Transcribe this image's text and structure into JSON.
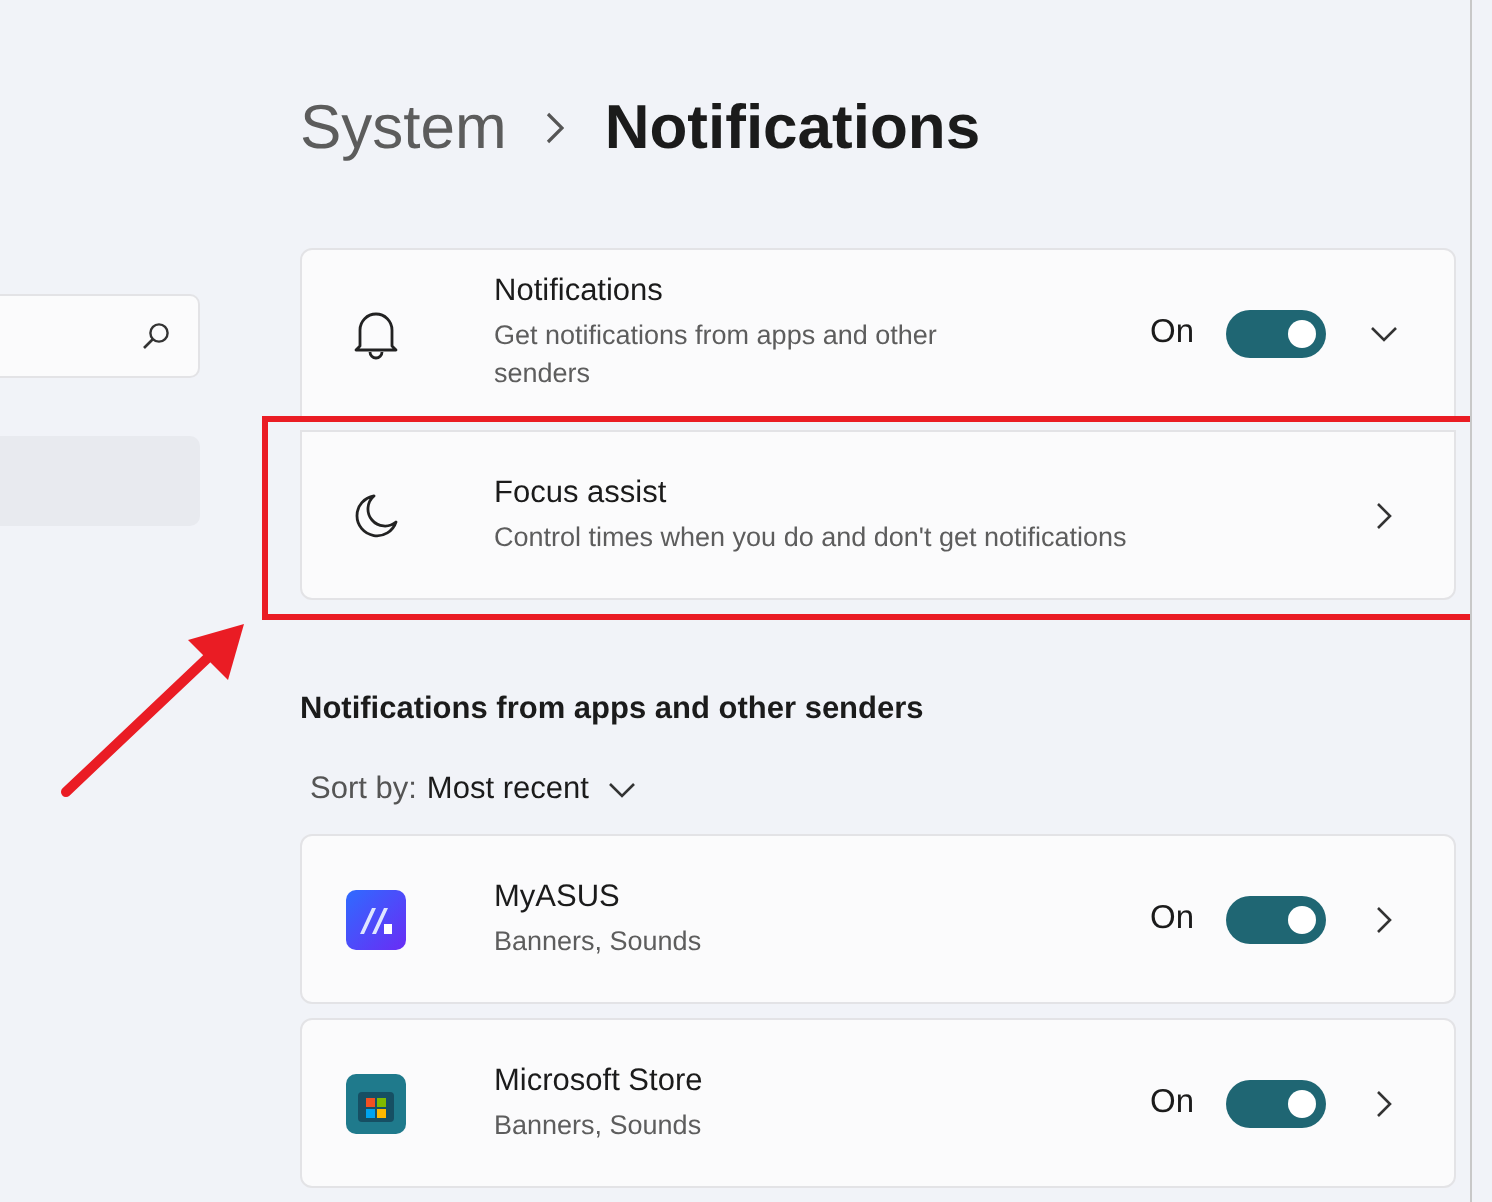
{
  "breadcrumb": [
    {
      "label": "System",
      "current": false
    },
    {
      "label": "Notifications",
      "current": true
    }
  ],
  "settings": [
    {
      "kind": "expander",
      "title": "Notifications",
      "description": "Get notifications from apps and other senders",
      "toggle": {
        "label": "On",
        "on": true
      },
      "expanded": false,
      "highlighted": false
    },
    {
      "kind": "link",
      "title": "Focus assist",
      "description": "Control times when you do and don't get notifications",
      "highlighted": true
    }
  ],
  "section_title": "Notifications from apps and other senders",
  "sort": {
    "label": "Sort by:",
    "value": "Most recent"
  },
  "apps": [
    {
      "name": "MyASUS",
      "description": "Banners, Sounds",
      "toggle": {
        "label": "On",
        "on": true
      }
    },
    {
      "name": "Microsoft Store",
      "description": "Banners, Sounds",
      "toggle": {
        "label": "On",
        "on": true
      }
    }
  ]
}
